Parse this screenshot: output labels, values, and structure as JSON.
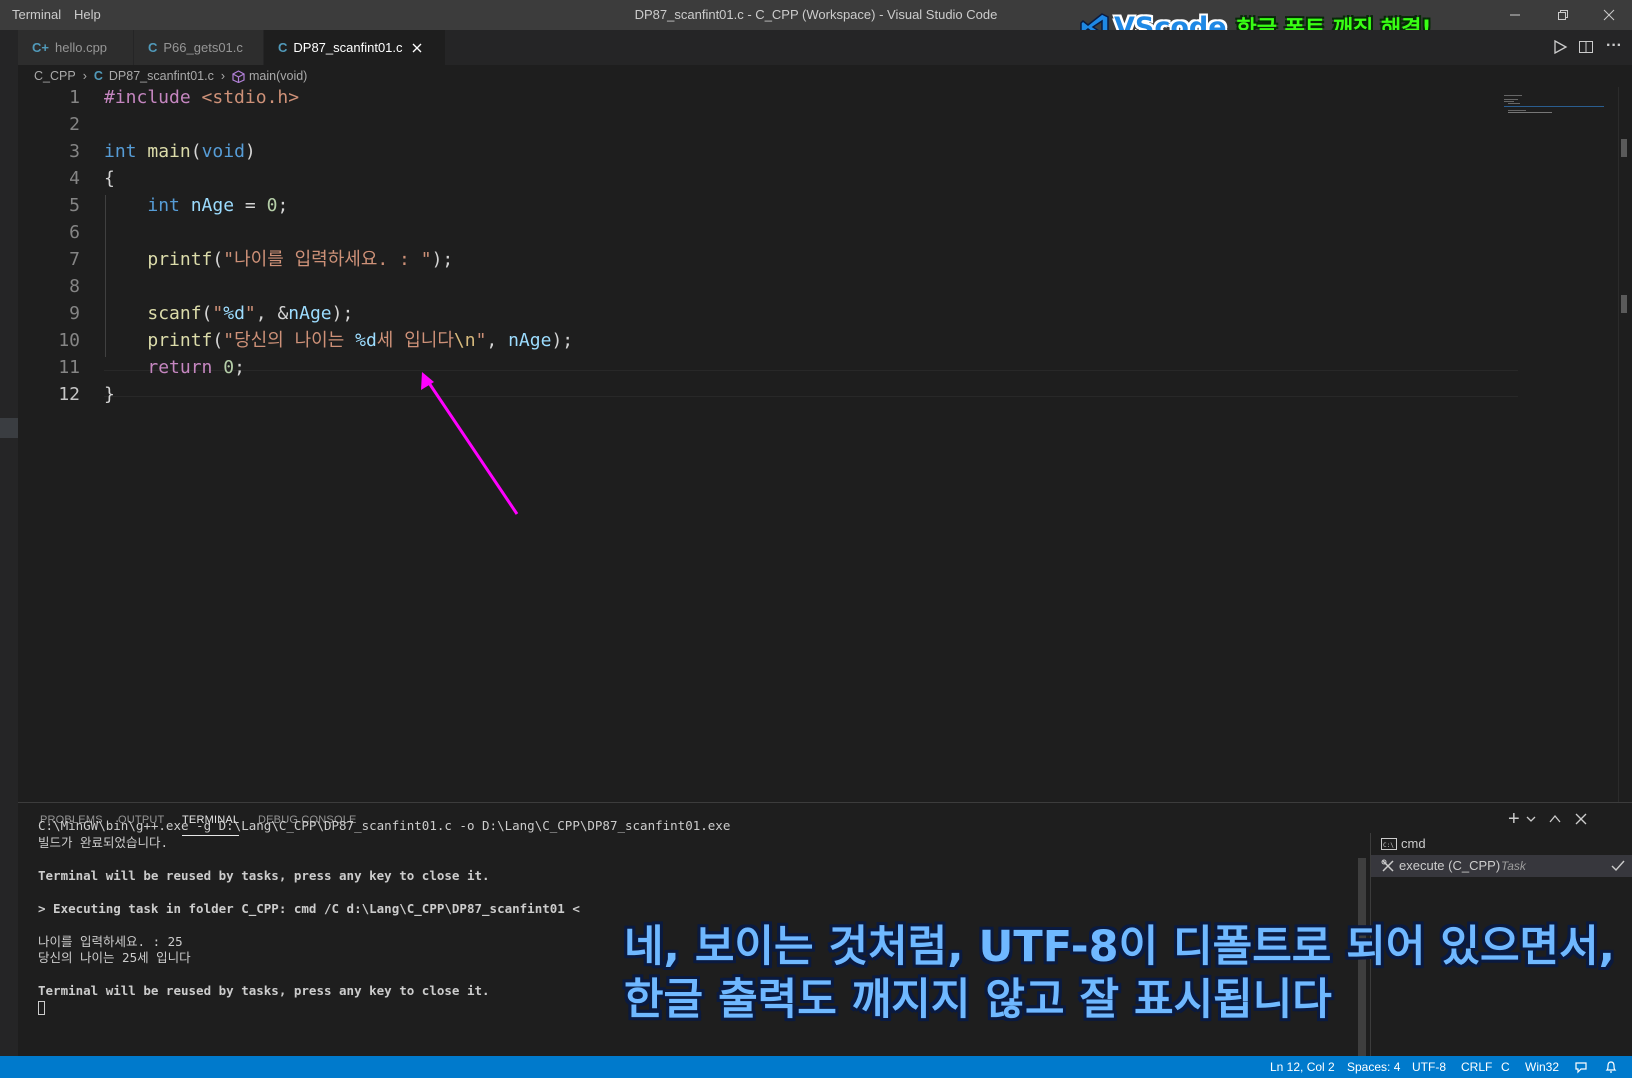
{
  "titlebar": {
    "menu_terminal": "Terminal",
    "menu_help": "Help",
    "title": "DP87_scanfint01.c - C_CPP (Workspace) - Visual Studio Code"
  },
  "overlay": {
    "logo_brand": "VScode",
    "logo_text": "한글 폰트 깨짐 해결!",
    "caption_line1": "네, 보이는 것처럼, UTF-8이 디폴트로 되어 있으면서,",
    "caption_line2": "한글 출력도 깨지지 않고 잘 표시됩니다"
  },
  "tabs": [
    {
      "label": "hello.cpp",
      "icon": "C+"
    },
    {
      "label": "P66_gets01.c",
      "icon": "C"
    },
    {
      "label": "DP87_scanfint01.c",
      "icon": "C",
      "active": true
    }
  ],
  "breadcrumb": {
    "folder": "C_CPP",
    "file": "DP87_scanfint01.c",
    "symbol": "main(void)"
  },
  "editor": {
    "line_numbers": [
      "1",
      "2",
      "3",
      "4",
      "5",
      "6",
      "7",
      "8",
      "9",
      "10",
      "11",
      "12"
    ],
    "lines": [
      "#include <stdio.h>",
      "",
      "int main(void)",
      "{",
      "    int nAge = 0;",
      "",
      "    printf(\"나이를 입력하세요. : \");",
      "",
      "    scanf(\"%d\", &nAge);",
      "    printf(\"당신의 나이는 %d세 입니다\\n\", nAge);",
      "    return 0;",
      "}"
    ]
  },
  "panel": {
    "tabs": [
      "PROBLEMS",
      "OUTPUT",
      "TERMINAL",
      "DEBUG CONSOLE"
    ],
    "active_tab": "TERMINAL",
    "terminal_lines": [
      "C:\\MinGW\\bin\\g++.exe -g D:\\Lang\\C_CPP\\DP87_scanfint01.c -o D:\\Lang\\C_CPP\\DP87_scanfint01.exe",
      "빌드가 완료되었습니다.",
      "",
      "Terminal will be reused by tasks, press any key to close it.",
      "",
      "> Executing task in folder C_CPP: cmd /C d:\\Lang\\C_CPP\\DP87_scanfint01 <",
      "",
      "나이를 입력하세요. : 25",
      "당신의 나이는 25세 입니다",
      "",
      "Terminal will be reused by tasks, press any key to close it."
    ],
    "terminals": [
      {
        "name": "cmd",
        "suffix": ""
      },
      {
        "name": "execute (C_CPP)",
        "suffix": "Task"
      }
    ]
  },
  "statusbar": {
    "position": "Ln 12, Col 2",
    "spaces": "Spaces: 4",
    "encoding": "UTF-8",
    "eol": "CRLF",
    "language": "C",
    "platform": "Win32"
  },
  "colors": {
    "statusbar": "#007acc",
    "annotation_arrow": "#ff00ff",
    "caption": "#6fb8ff",
    "logo_green": "#39ff14"
  }
}
